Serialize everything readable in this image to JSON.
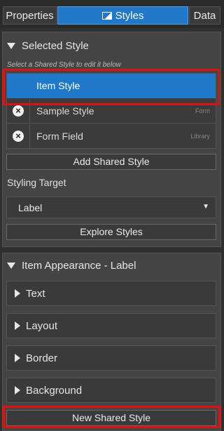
{
  "tabs": [
    {
      "label": "Properties",
      "active": false
    },
    {
      "label": "Styles",
      "active": true,
      "icon": "image-icon"
    },
    {
      "label": "Data",
      "active": false
    }
  ],
  "selected_style": {
    "header": "Selected Style",
    "hint": "Select a Shared Style to edit it below",
    "styles": [
      {
        "name": "Item Style",
        "tag": "",
        "selected": true
      },
      {
        "name": "Sample Style",
        "tag": "Form",
        "selected": false
      },
      {
        "name": "Form Field",
        "tag": "Library",
        "selected": false
      }
    ],
    "add_button": "Add Shared Style",
    "styling_target_label": "Styling Target",
    "styling_target_value": "Label",
    "explore_button": "Explore Styles"
  },
  "appearance": {
    "header": "Item Appearance - Label",
    "sections": [
      "Text",
      "Layout",
      "Border",
      "Background"
    ],
    "new_button": "New Shared Style"
  },
  "colors": {
    "accent": "#1f78c8",
    "highlight": "#e01010"
  }
}
